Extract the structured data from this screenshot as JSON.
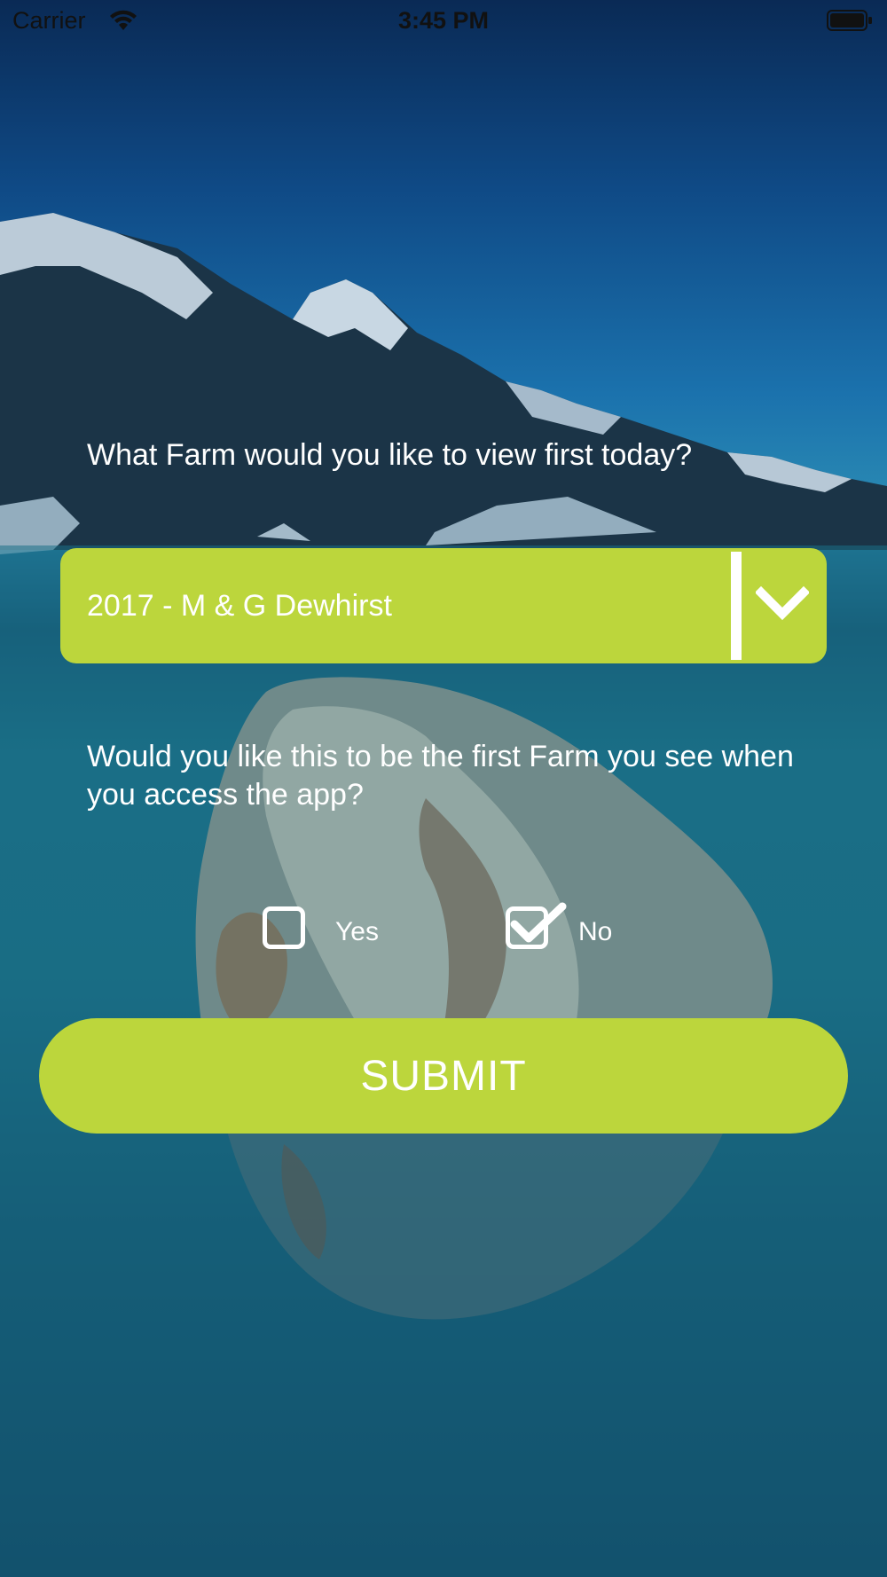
{
  "status_bar": {
    "carrier": "Carrier",
    "time": "3:45 PM",
    "icons": [
      "wifi-icon",
      "battery-icon"
    ]
  },
  "form": {
    "farm_question": "What Farm would you like to view first today?",
    "farm_select": {
      "selected_value": "2017 - M & G Dewhirst",
      "icon": "chevron-down-icon"
    },
    "default_question": "Would you like this to be the first Farm you see when you access the app?",
    "options": [
      {
        "label": "Yes",
        "checked": false
      },
      {
        "label": "No",
        "checked": true
      }
    ],
    "submit_label": "SUBMIT"
  },
  "colors": {
    "accent": "#bcd63c",
    "text": "#ffffff"
  }
}
